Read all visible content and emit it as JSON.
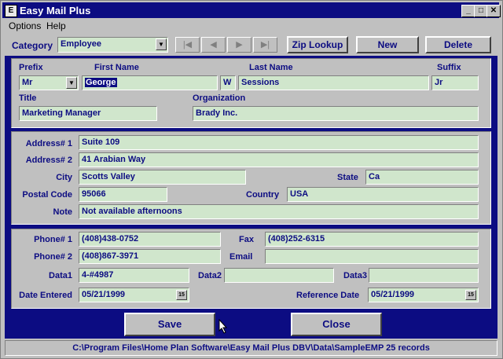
{
  "window": {
    "title": "Easy Mail Plus",
    "icon_letter": "E"
  },
  "menu": {
    "options": "Options",
    "help": "Help"
  },
  "toolbar": {
    "category_label": "Category",
    "category_value": "Employee",
    "zip_lookup": "Zip Lookup",
    "new": "New",
    "delete": "Delete",
    "nav_first": "|◀",
    "nav_prev": "◀",
    "nav_next": "▶",
    "nav_last": "▶|"
  },
  "name": {
    "prefix_label": "Prefix",
    "prefix_value": "Mr",
    "first_label": "First Name",
    "first_value": "George",
    "middle_value": "W",
    "last_label": "Last Name",
    "last_value": "Sessions",
    "suffix_label": "Suffix",
    "suffix_value": "Jr",
    "title_label": "Title",
    "title_value": "Marketing Manager",
    "org_label": "Organization",
    "org_value": "Brady Inc."
  },
  "address": {
    "addr1_label": "Address# 1",
    "addr1_value": "Suite 109",
    "addr2_label": "Address# 2",
    "addr2_value": "41 Arabian Way",
    "city_label": "City",
    "city_value": "Scotts Valley",
    "state_label": "State",
    "state_value": "Ca",
    "postal_label": "Postal Code",
    "postal_value": "95066",
    "country_label": "Country",
    "country_value": "USA",
    "note_label": "Note",
    "note_value": "Not available afternoons"
  },
  "contact": {
    "phone1_label": "Phone# 1",
    "phone1_value": "(408)438-0752",
    "fax_label": "Fax",
    "fax_value": "(408)252-6315",
    "phone2_label": "Phone# 2",
    "phone2_value": "(408)867-3971",
    "email_label": "Email",
    "email_value": "",
    "data1_label": "Data1",
    "data1_value": "4-#4987",
    "data2_label": "Data2",
    "data2_value": "",
    "data3_label": "Data3",
    "data3_value": "",
    "date_entered_label": "Date Entered",
    "date_entered_value": "05/21/1999",
    "ref_date_label": "Reference Date",
    "ref_date_value": "05/21/1999",
    "cal_icon_text": "15"
  },
  "actions": {
    "save": "Save",
    "close": "Close"
  },
  "status": {
    "text": "C:\\Program Files\\Home Plan Software\\Easy Mail Plus DBV\\Data\\SampleEMP   25 records"
  }
}
